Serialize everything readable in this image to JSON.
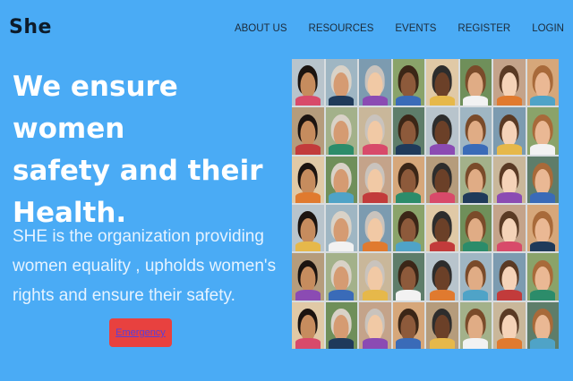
{
  "brand": {
    "logo": "She"
  },
  "nav": {
    "items": [
      {
        "label": "ABOUT US",
        "name": "nav-about-us"
      },
      {
        "label": "RESOURCES",
        "name": "nav-resources"
      },
      {
        "label": "EVENTS",
        "name": "nav-events"
      },
      {
        "label": "REGISTER",
        "name": "nav-register"
      },
      {
        "label": "LOGIN",
        "name": "nav-login"
      }
    ]
  },
  "hero": {
    "headline": [
      "We ensure women",
      "safety and their",
      "Health."
    ],
    "lead": [
      "SHE is the organization providing",
      "women equality , upholds women's",
      "rights and ensure their safety."
    ],
    "button_label": "Emergency"
  },
  "colors": {
    "background": "#4aabf5",
    "button": "#e8413f",
    "headline": "#ffffff"
  }
}
